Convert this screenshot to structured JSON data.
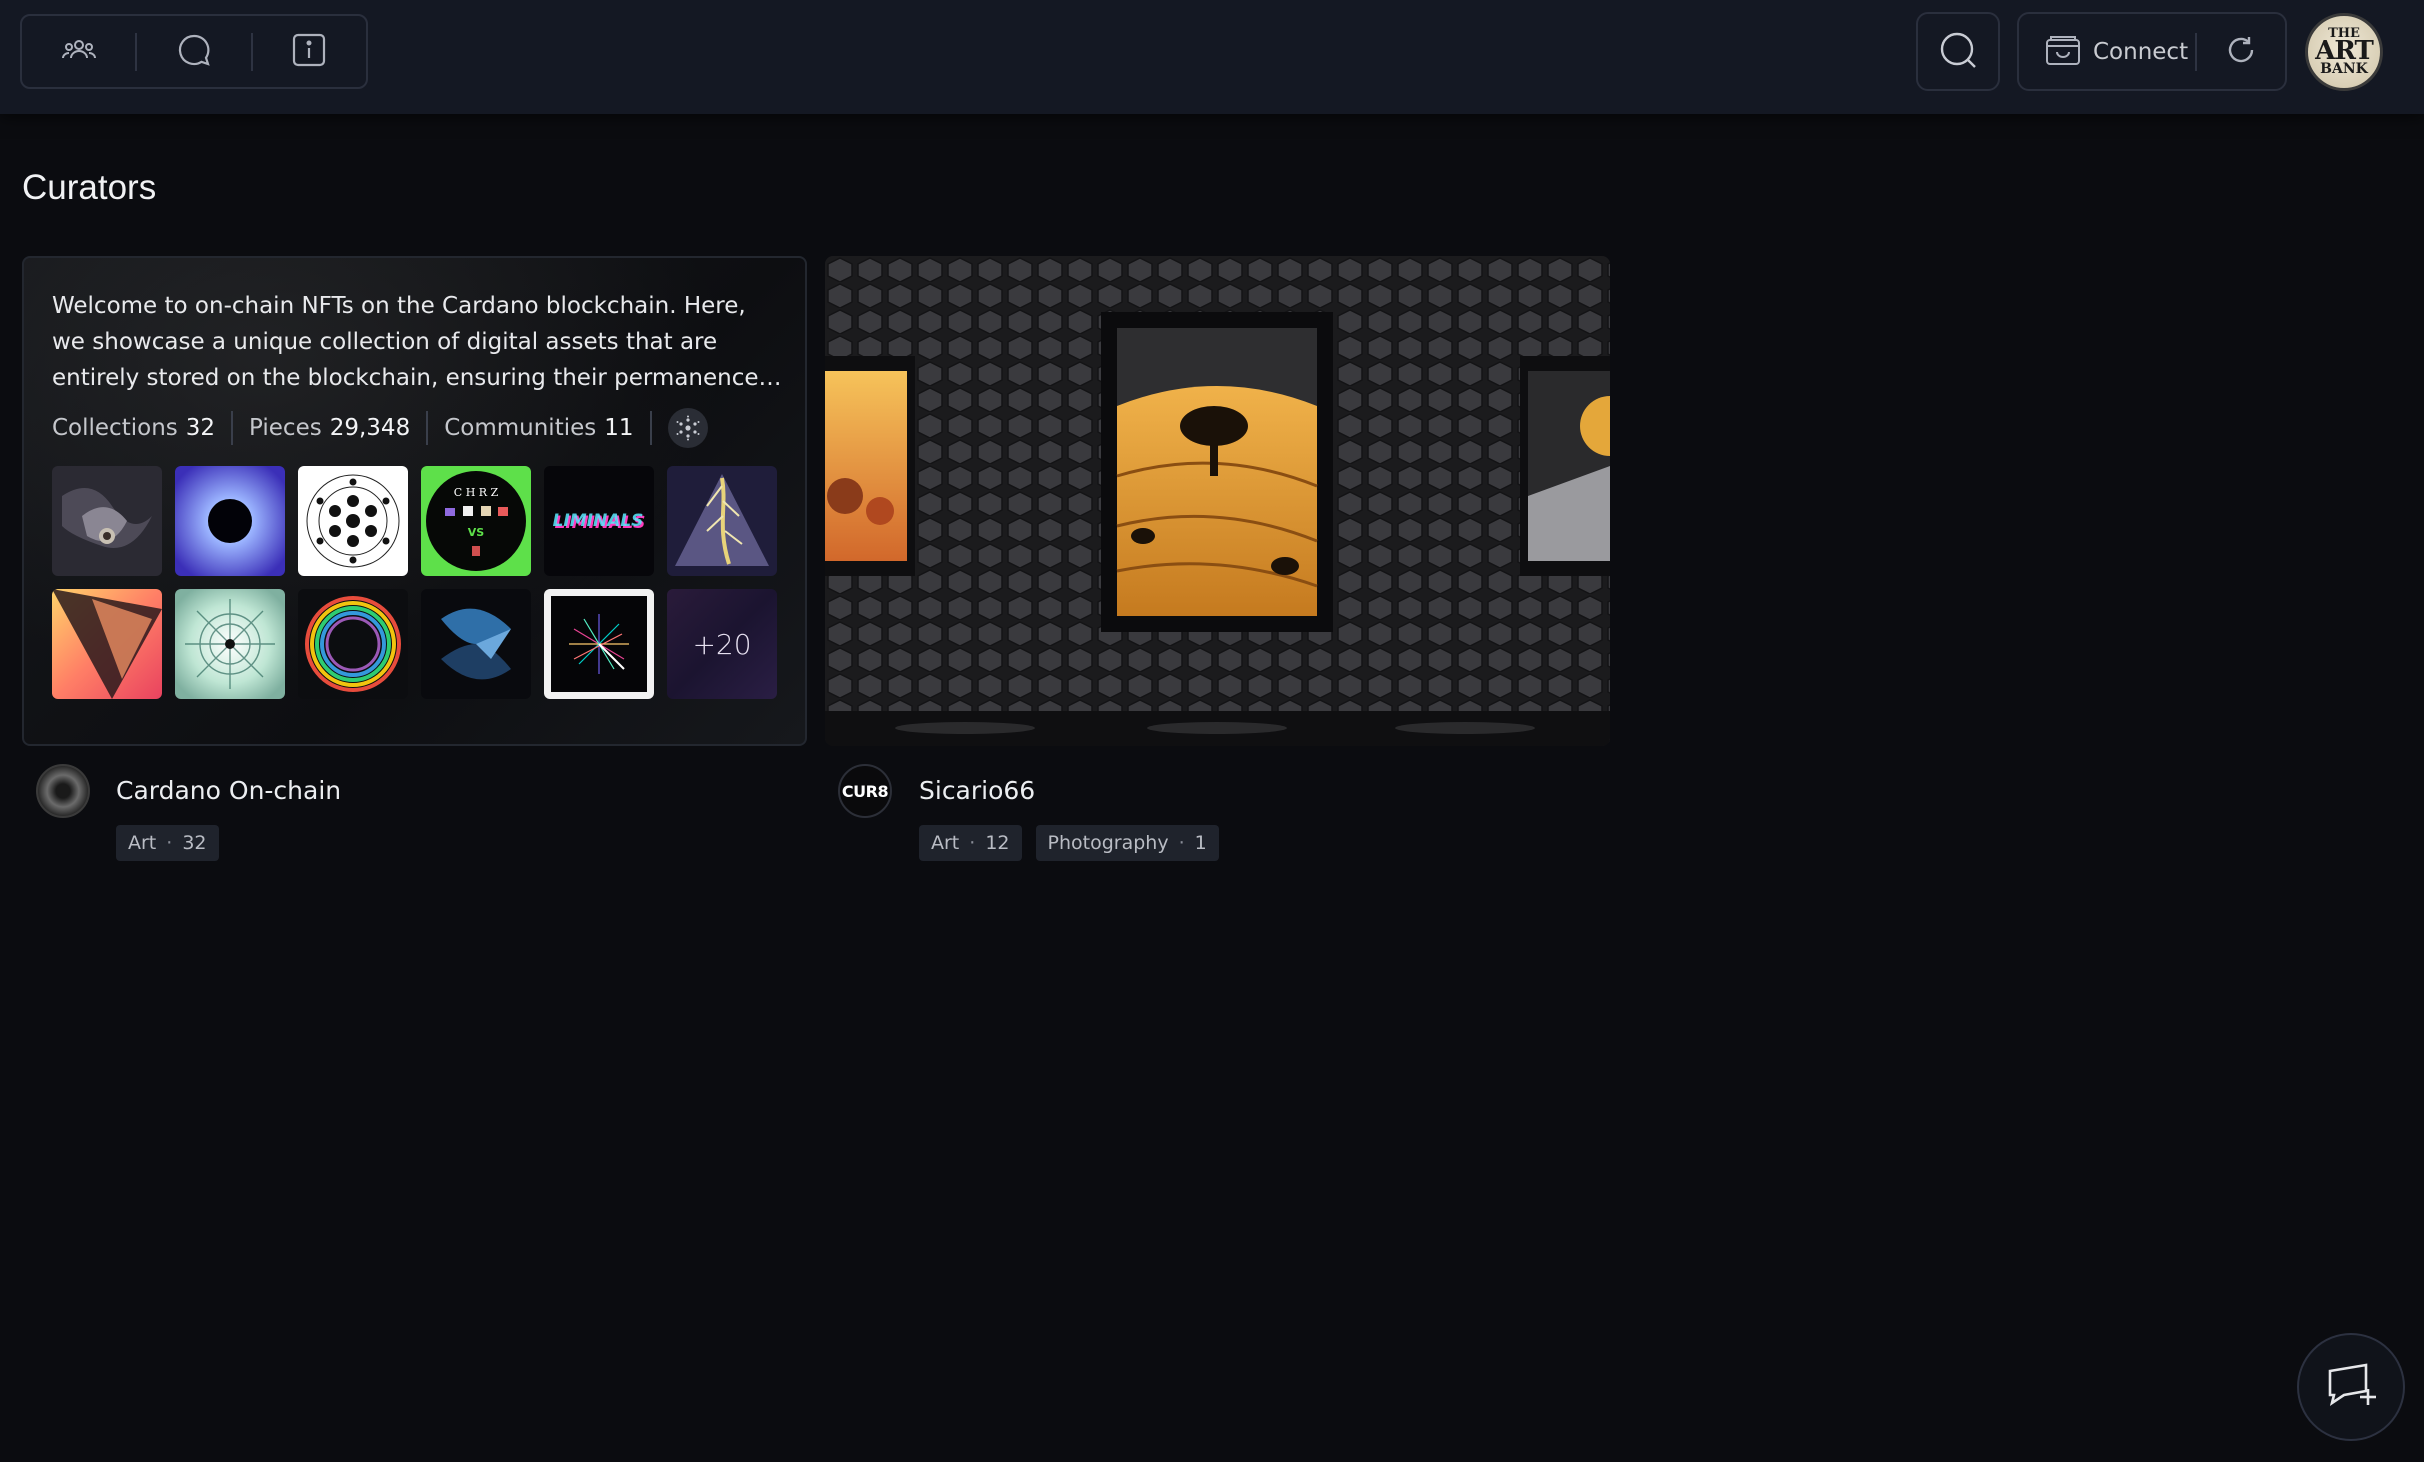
{
  "topbar": {
    "left_buttons": [
      {
        "icon": "users-icon"
      },
      {
        "icon": "chat-icon"
      },
      {
        "icon": "info-icon"
      }
    ],
    "search_icon": "search-icon",
    "connect_label": "Connect",
    "refresh_icon": "refresh-icon",
    "logo": {
      "line1": "THE",
      "line2": "ART",
      "line3": "BANK"
    }
  },
  "page": {
    "title": "Curators"
  },
  "curators": [
    {
      "name": "Cardano On-chain",
      "description": "Welcome to on-chain NFTs on the Cardano blockchain. Here, we showcase a unique collection of digital assets that are entirely stored on the blockchain, ensuring their permanence and integrity.",
      "stats": {
        "collections_label": "Collections",
        "collections_value": "32",
        "pieces_label": "Pieces",
        "pieces_value": "29,348",
        "communities_label": "Communities",
        "communities_value": "11"
      },
      "chain_icon": "cardano-icon",
      "more_label": "+20",
      "tags": [
        {
          "label": "Art",
          "count": "32"
        }
      ],
      "thumb_text": {
        "chrz_title": "C H R Z",
        "chrz_vs": "VS",
        "liminals": "LIMINALS"
      }
    },
    {
      "name": "Sicario66",
      "avatar_text": "CUR8",
      "tags": [
        {
          "label": "Art",
          "count": "12"
        },
        {
          "label": "Photography",
          "count": "1"
        }
      ]
    }
  ],
  "fab": {
    "icon": "add-screen-icon"
  },
  "colors": {
    "background": "#0b0c10",
    "topbar": "#141823",
    "tag_bg": "#1f232c"
  }
}
